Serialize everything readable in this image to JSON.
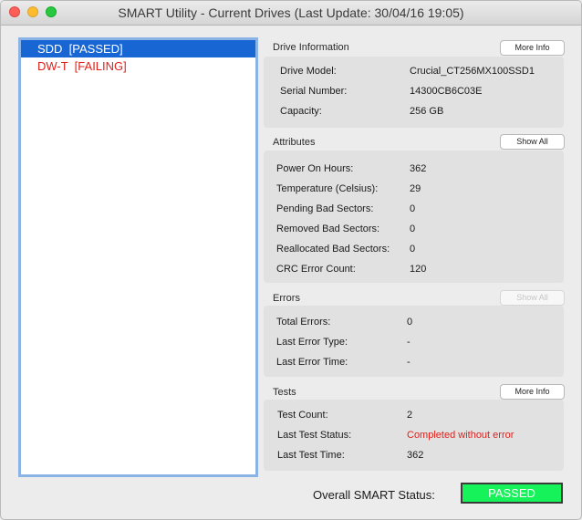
{
  "window": {
    "title": "SMART Utility - Current Drives (Last Update: 30/04/16 19:05)"
  },
  "drives": [
    {
      "label": "SDD  [PASSED]",
      "status": "passed"
    },
    {
      "label": "DW-T  [FAILING]",
      "status": "failing"
    }
  ],
  "drive_info": {
    "title": "Drive Information",
    "button": "More Info",
    "rows": [
      {
        "label": "Drive Model:",
        "value": "Crucial_CT256MX100SSD1"
      },
      {
        "label": "Serial Number:",
        "value": "14300CB6C03E"
      },
      {
        "label": "Capacity:",
        "value": "256 GB"
      }
    ]
  },
  "attributes": {
    "title": "Attributes",
    "button": "Show All",
    "rows": [
      {
        "label": "Power On Hours:",
        "value": "362"
      },
      {
        "label": "Temperature (Celsius):",
        "value": "29"
      },
      {
        "label": "Pending Bad Sectors:",
        "value": "0"
      },
      {
        "label": "Removed Bad Sectors:",
        "value": "0"
      },
      {
        "label": "Reallocated Bad Sectors:",
        "value": "0"
      },
      {
        "label": "CRC Error Count:",
        "value": "120"
      }
    ]
  },
  "errors": {
    "title": "Errors",
    "button": "Show All",
    "rows": [
      {
        "label": "Total Errors:",
        "value": "0"
      },
      {
        "label": "Last Error Type:",
        "value": "-"
      },
      {
        "label": "Last Error Time:",
        "value": "-"
      }
    ]
  },
  "tests": {
    "title": "Tests",
    "button": "More Info",
    "rows": [
      {
        "label": "Test Count:",
        "value": "2"
      },
      {
        "label": "Last Test Status:",
        "value": "Completed without error"
      },
      {
        "label": "Last Test Time:",
        "value": "362"
      }
    ]
  },
  "overall": {
    "label": "Overall SMART Status:",
    "status": "PASSED"
  },
  "colors": {
    "passed_badge": "#16f25a",
    "failing_text": "#e0201b",
    "selection": "#1866d3"
  }
}
